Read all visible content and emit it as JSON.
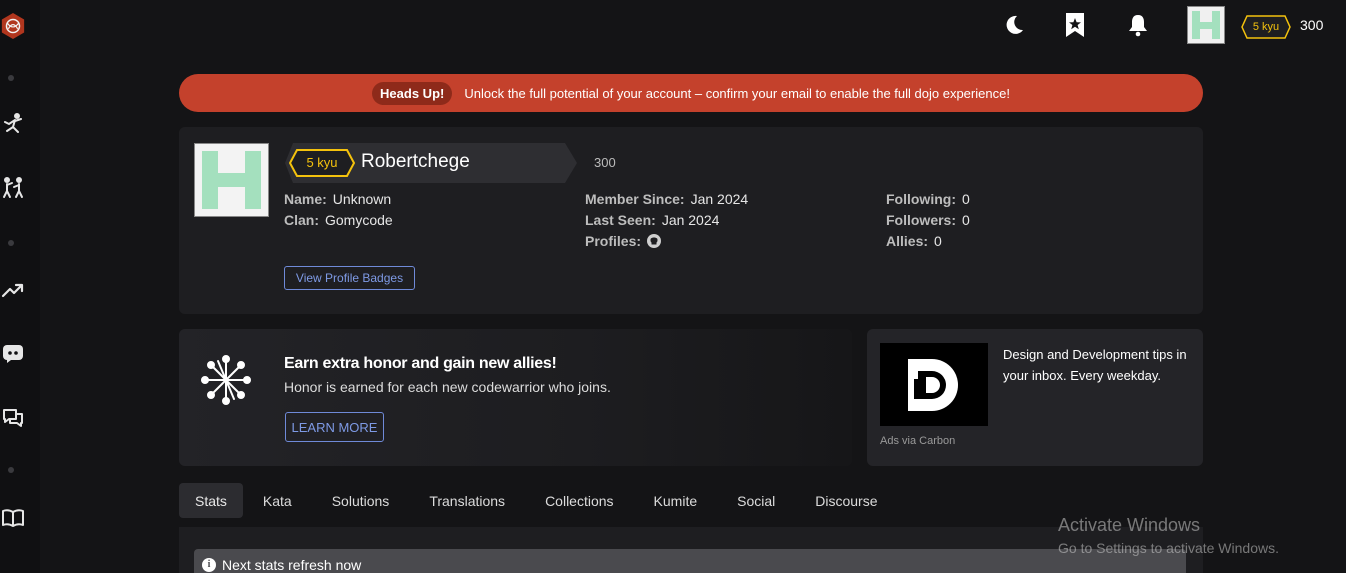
{
  "topbar": {
    "rank": "5 kyu",
    "honor": "300"
  },
  "alert": {
    "badge": "Heads Up!",
    "message": "Unlock the full potential of your account – confirm your email to enable the full dojo experience!"
  },
  "profile": {
    "rank": "5 kyu",
    "username": "Robertchege",
    "honor": "300",
    "col1": [
      {
        "label": "Name:",
        "value": "Unknown"
      },
      {
        "label": "Clan:",
        "value": "Gomycode"
      }
    ],
    "col2": [
      {
        "label": "Member Since:",
        "value": "Jan 2024"
      },
      {
        "label": "Last Seen:",
        "value": "Jan 2024"
      },
      {
        "label": "Profiles:",
        "value": ""
      }
    ],
    "col3": [
      {
        "label": "Following:",
        "value": "0"
      },
      {
        "label": "Followers:",
        "value": "0"
      },
      {
        "label": "Allies:",
        "value": "0"
      }
    ],
    "badges_button": "View Profile Badges"
  },
  "promo": {
    "title": "Earn extra honor and gain new allies!",
    "subtitle": "Honor is earned for each new codewarrior who joins.",
    "button": "LEARN MORE"
  },
  "ad": {
    "text": "Design and Development tips in your inbox. Every weekday.",
    "via": "Ads via Carbon"
  },
  "tabs": [
    "Stats",
    "Kata",
    "Solutions",
    "Translations",
    "Collections",
    "Kumite",
    "Social",
    "Discourse"
  ],
  "stats_note": "Next stats refresh now",
  "watermark": {
    "title": "Activate Windows",
    "subtitle": "Go to Settings to activate Windows."
  },
  "colors": {
    "accent_red": "#c4412c",
    "rank_yellow": "#f4c20d",
    "link_blue": "#7e9ae5",
    "identicon_green": "#a4e0be"
  },
  "icons": [
    "codewars-logo-icon",
    "practice-icon",
    "kumite-icon",
    "leaderboard-icon",
    "discord-icon",
    "forum-icon",
    "docs-icon",
    "moon-icon",
    "bookmark-icon",
    "bell-icon",
    "github-icon",
    "honor-network-icon",
    "info-icon"
  ]
}
